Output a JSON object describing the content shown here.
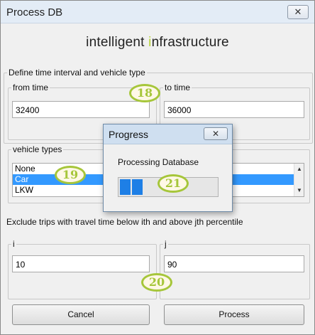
{
  "window": {
    "title": "Process DB",
    "close_glyph": "✕"
  },
  "logo": {
    "prefix": "intelligent ",
    "accent": "i",
    "suffix": "nfrastructure",
    "accent_color": "#b7d333"
  },
  "time_group": {
    "label": "Define time interval and vehicle type",
    "from": {
      "label": "from time",
      "value": "32400"
    },
    "to": {
      "label": "to time",
      "value": "36000"
    }
  },
  "vehicle_group": {
    "label": "vehicle types",
    "items": [
      "None",
      "Car",
      "LKW"
    ],
    "selected": "Car"
  },
  "exclude_text": "Exclude trips with travel time below ith and above jth percentile",
  "percentile": {
    "i": {
      "label": "i",
      "value": "10"
    },
    "j": {
      "label": "j",
      "value": "90"
    }
  },
  "buttons": {
    "cancel": "Cancel",
    "process": "Process"
  },
  "progress_dialog": {
    "title": "Progress",
    "close_glyph": "✕",
    "label": "Processing Database",
    "blocks_filled": 2
  },
  "annotations": [
    "18",
    "19",
    "20",
    "21"
  ],
  "colors": {
    "badge": "#a6c63a",
    "selection": "#3399ff",
    "progress": "#1e7fe6"
  }
}
